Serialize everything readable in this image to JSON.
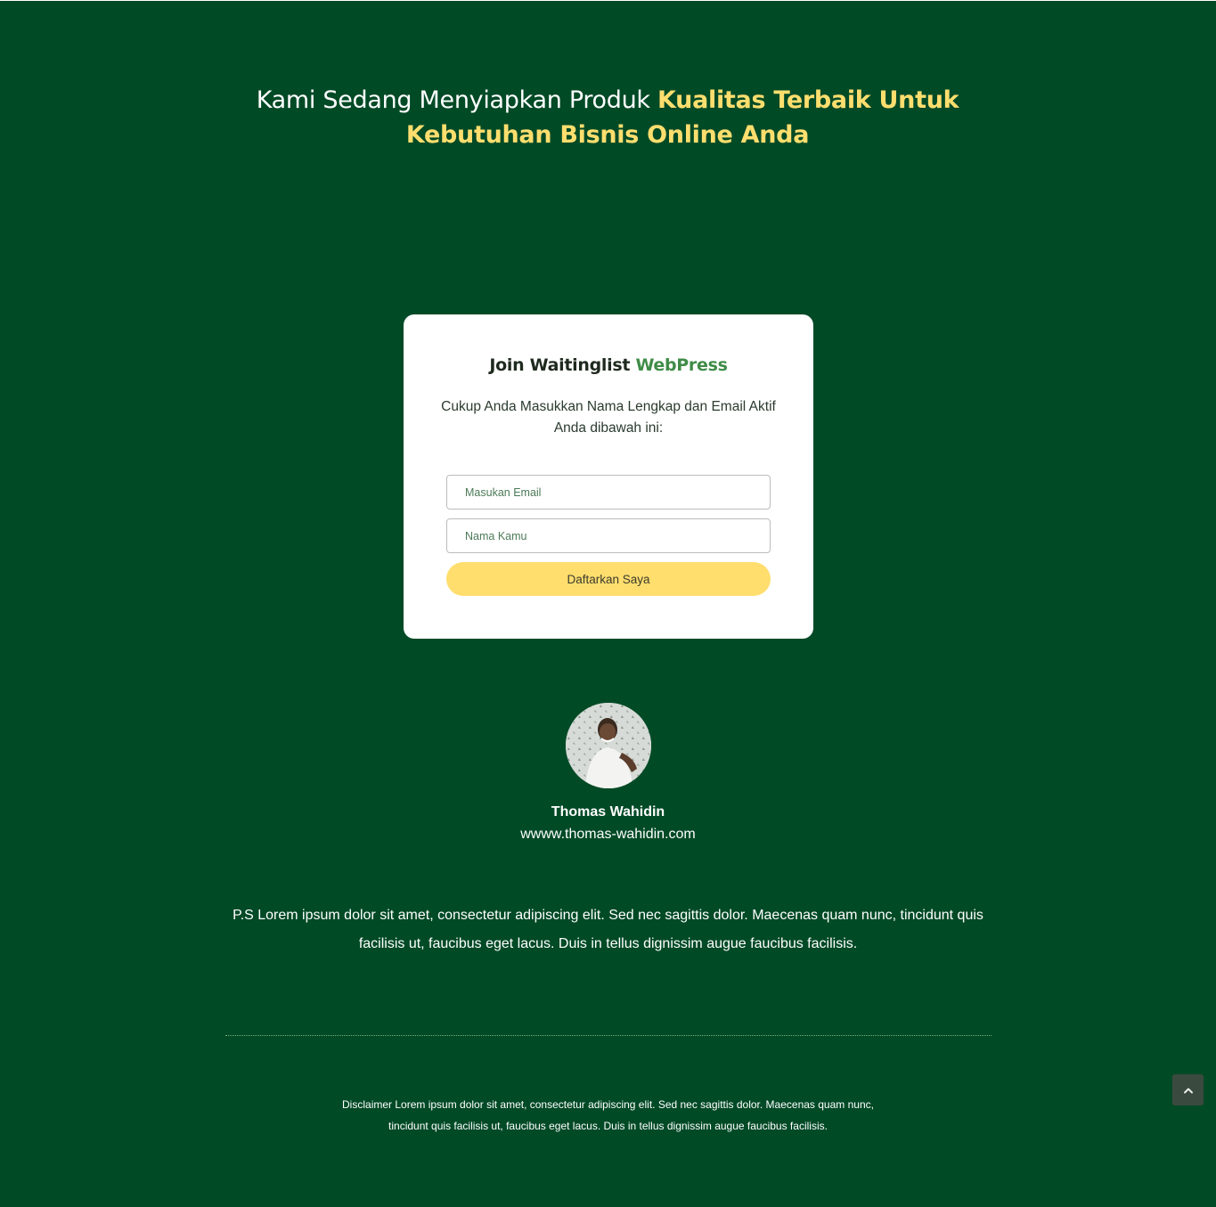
{
  "hero": {
    "headline_plain": "Kami Sedang Menyiapkan Produk ",
    "headline_accent": "Kualitas Terbaik Untuk Kebutuhan Bisnis Online Anda"
  },
  "signup_card": {
    "title_plain": "Join Waitinglist ",
    "title_brand": "WebPress",
    "description": "Cukup Anda Masukkan Nama Lengkap dan Email Aktif Anda dibawah ini:",
    "email_placeholder": "Masukan Email",
    "name_placeholder": "Nama Kamu",
    "submit_label": "Daftarkan Saya"
  },
  "author": {
    "name": "Thomas Wahidin",
    "website": "wwww.thomas-wahidin.com"
  },
  "ps_text": "P.S Lorem ipsum dolor sit amet, consectetur adipiscing elit. Sed nec sagittis dolor. Maecenas quam nunc, tincidunt quis facilisis ut, faucibus eget lacus. Duis in tellus dignissim augue faucibus facilisis.",
  "footer": {
    "disclaimer": "Disclaimer Lorem ipsum dolor sit amet, consectetur adipiscing elit. Sed nec sagittis dolor. Maecenas quam nunc, tincidunt quis facilisis ut, faucibus eget lacus. Duis in tellus dignissim augue faucibus facilisis."
  },
  "icons": {
    "scroll_top": "chevron-up-icon",
    "avatar": "person-photo"
  },
  "colors": {
    "background": "#014a26",
    "accent_yellow": "#ffde6e",
    "brand_green": "#3f8c48",
    "card": "#ffffff"
  }
}
